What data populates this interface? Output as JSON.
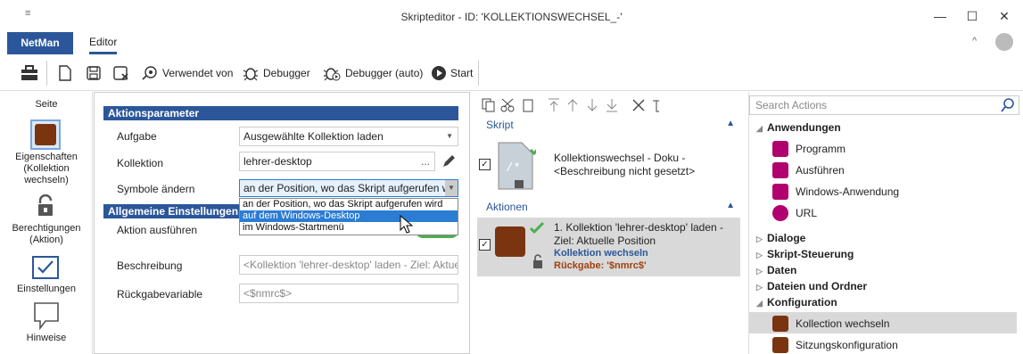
{
  "window": {
    "title": "Skripteditor - ID: 'KOLLEKTIONSWECHSEL_-'",
    "qat_glyph": "≡",
    "minimize": "—",
    "maximize": "☐",
    "close": "✕"
  },
  "ribbon": {
    "tabs": [
      {
        "label": "NetMan"
      },
      {
        "label": "Editor"
      }
    ],
    "collapse": "^"
  },
  "toolbar": {
    "verwendet_von": "Verwendet von",
    "debugger": "Debugger",
    "debugger_auto": "Debugger (auto)",
    "start": "Start"
  },
  "sidetabs": {
    "header": "Seite",
    "items": [
      {
        "label": "Eigenschaften\n(Kollektion\nwechseln)"
      },
      {
        "label": "Berechtigungen\n(Aktion)"
      },
      {
        "label": "Einstellungen"
      },
      {
        "label": "Hinweise"
      }
    ]
  },
  "params": {
    "group1": "Aktionsparameter",
    "aufgabe_label": "Aufgabe",
    "aufgabe_value": "Ausgewählte Kollektion laden",
    "kollektion_label": "Kollektion",
    "kollektion_value": "lehrer-desktop",
    "kollektion_more": "...",
    "symbole_label": "Symbole ändern",
    "symbole_value": "an der Position, wo das Skript aufgerufen wird",
    "symbole_options": [
      "an der Position, wo das Skript aufgerufen wird",
      "auf dem Windows-Desktop",
      "im Windows-Startmenü"
    ],
    "group2": "Allgemeine Einstellungen",
    "ausfuehren_label": "Aktion ausführen",
    "beschreibung_label": "Beschreibung",
    "beschreibung_placeholder": "<Kollektion 'lehrer-desktop' laden - Ziel: Aktuel...",
    "rueckgabe_label": "Rückgabevariable",
    "rueckgabe_placeholder": "<$nmrc$>"
  },
  "script": {
    "section": "Skript",
    "doc_title": "Kollektionswechsel - Doku -",
    "doc_desc": "<Beschreibung nicht gesetzt>",
    "actions_section": "Aktionen",
    "action_title": "1. Kollektion 'lehrer-desktop' laden -",
    "action_subtitle": "Ziel: Aktuelle Position",
    "action_type": "Kollektion wechseln",
    "action_return": "Rückgabe: '$nmrc$'"
  },
  "actions_panel": {
    "search_placeholder": "Search Actions",
    "anwendungen": "Anwendungen",
    "anwendungen_items": [
      {
        "label": "Programm",
        "color": "#b0006e"
      },
      {
        "label": "Ausführen",
        "color": "#b0006e"
      },
      {
        "label": "Windows-Anwendung",
        "color": "#b0006e"
      },
      {
        "label": "URL",
        "color": "#b0006e"
      }
    ],
    "dialoge": "Dialoge",
    "skript_steuerung": "Skript-Steuerung",
    "daten": "Daten",
    "dateien": "Dateien und Ordner",
    "konfiguration": "Konfiguration",
    "konfig_items": [
      {
        "label": "Kollection wechseln",
        "color": "#8b3a0e"
      },
      {
        "label": "Sitzungskonfiguration",
        "color": "#8b3a0e"
      }
    ]
  },
  "colors": {
    "accent": "#2b579a",
    "selection": "#2b7cd3",
    "brown_icon": "#7a3510",
    "magenta_icon": "#b0006e"
  }
}
